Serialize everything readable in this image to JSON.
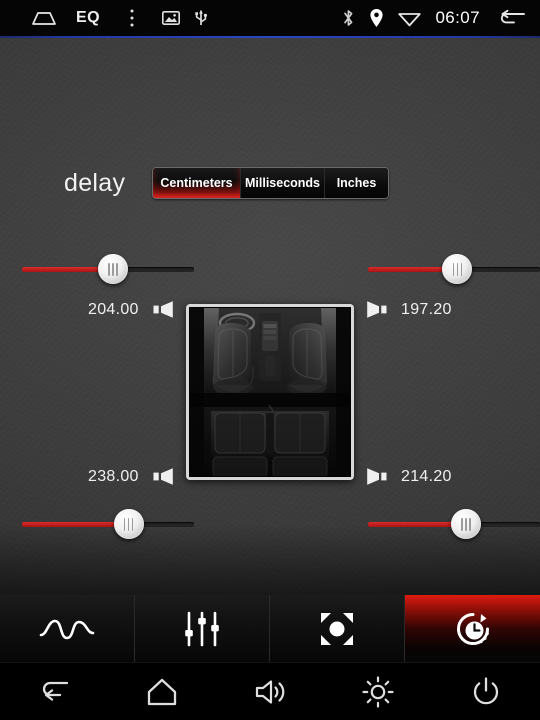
{
  "statusbar": {
    "left_icons": [
      {
        "name": "home-outline-icon",
        "label": "home"
      },
      {
        "name": "eq-label",
        "label": "EQ"
      },
      {
        "name": "overflow-menu-icon",
        "label": "menu"
      },
      {
        "name": "gallery-icon",
        "label": "gallery"
      },
      {
        "name": "usb-icon",
        "label": "usb"
      }
    ],
    "eq_label": "EQ",
    "right_icons": [
      {
        "name": "bluetooth-icon",
        "label": "bluetooth"
      },
      {
        "name": "location-pin-icon",
        "label": "location"
      },
      {
        "name": "wifi-icon",
        "label": "wifi"
      }
    ],
    "time": "06:07",
    "back_label": "back"
  },
  "main": {
    "title": "delay",
    "units": {
      "options": [
        "Centimeters",
        "Milliseconds",
        "Inches"
      ],
      "selected": "Centimeters"
    },
    "channels": [
      {
        "id": "front-left",
        "position": "top-left",
        "value": "204.00",
        "slider_percent": 53,
        "speaker_icon": "speaker-left-icon"
      },
      {
        "id": "front-right",
        "position": "top-right",
        "value": "197.20",
        "slider_percent": 52,
        "speaker_icon": "speaker-right-icon"
      },
      {
        "id": "rear-left",
        "position": "bottom-left",
        "value": "238.00",
        "slider_percent": 62,
        "speaker_icon": "speaker-left-icon"
      },
      {
        "id": "rear-right",
        "position": "bottom-right",
        "value": "214.20",
        "slider_percent": 57,
        "speaker_icon": "speaker-right-icon"
      }
    ],
    "car_diagram": {
      "name": "car-interior-seats-image",
      "alt": "car interior top view with front and rear seats"
    },
    "colors": {
      "accent_red": "#c42020",
      "slider_fill": "#d92b2b",
      "track": "#232323",
      "text": "#f0f0f0"
    }
  },
  "toolbar": {
    "items": [
      {
        "name": "tab-waveform",
        "icon": "waveform-icon",
        "label": "waveform",
        "active": false
      },
      {
        "name": "tab-equalizer",
        "icon": "sliders-icon",
        "label": "equalizer",
        "active": false
      },
      {
        "name": "tab-balance",
        "icon": "balance-fader-icon",
        "label": "balance",
        "active": false
      },
      {
        "name": "tab-time-delay",
        "icon": "clock-delay-icon",
        "label": "time delay",
        "active": true
      }
    ]
  },
  "navbar": {
    "items": [
      {
        "name": "nav-back",
        "icon": "back-arrow-icon",
        "label": "back"
      },
      {
        "name": "nav-home",
        "icon": "home-icon",
        "label": "home"
      },
      {
        "name": "nav-volume",
        "icon": "volume-icon",
        "label": "volume"
      },
      {
        "name": "nav-brightness",
        "icon": "brightness-icon",
        "label": "brightness"
      },
      {
        "name": "nav-power",
        "icon": "power-icon",
        "label": "power"
      }
    ]
  }
}
